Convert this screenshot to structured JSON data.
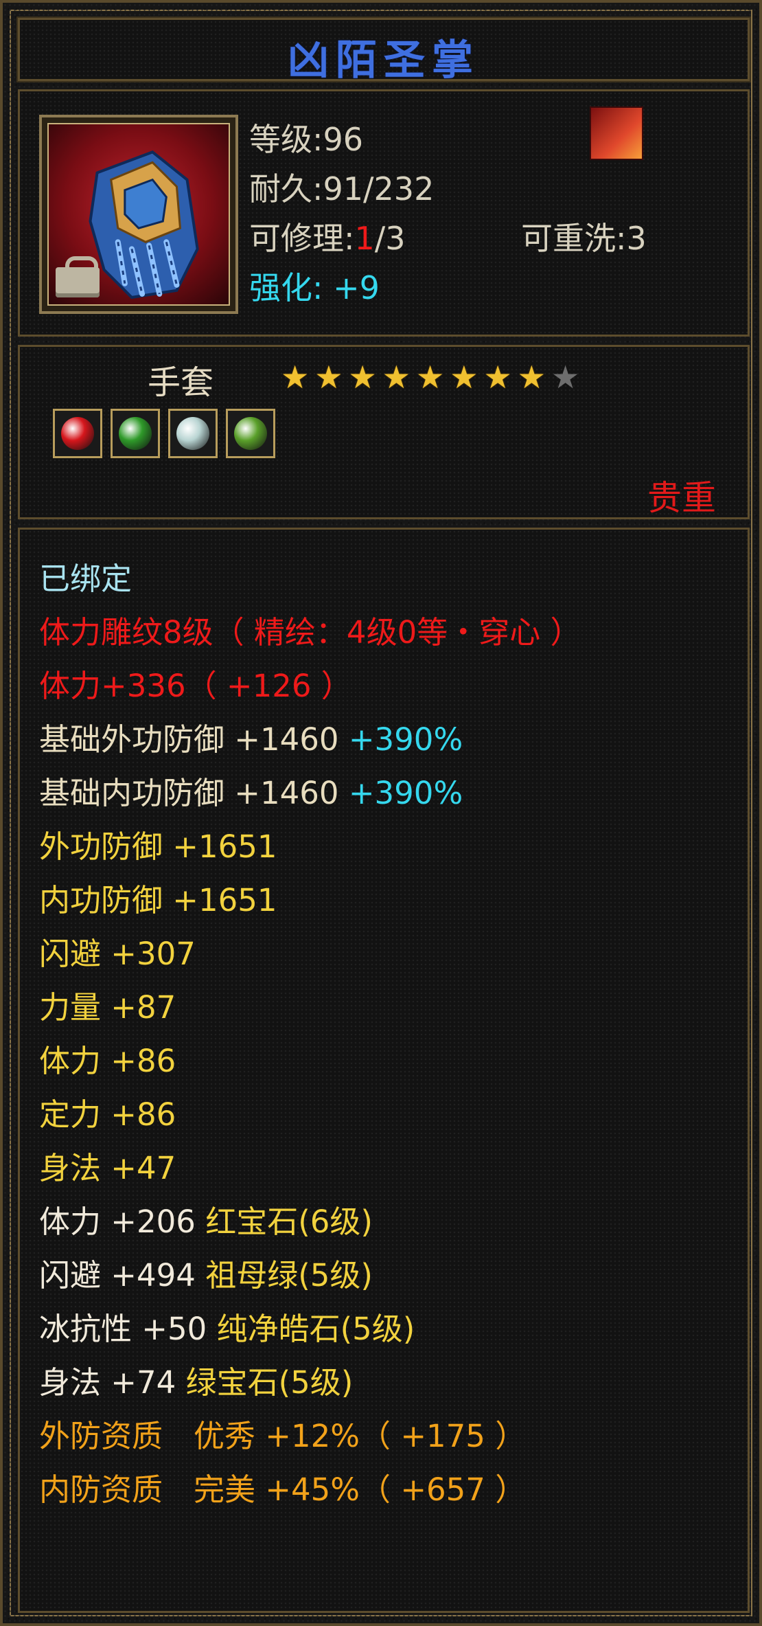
{
  "item": {
    "name": "凶陌圣掌",
    "type": "手套",
    "rarity": "贵重"
  },
  "stats": {
    "level_label": "等级:96",
    "durability_label": "耐久:91/232",
    "repair_prefix": "可修理:",
    "repair_used": "1",
    "repair_total": "/3",
    "rewash_label": "可重洗:3",
    "enhance_label": "强化:",
    "enhance_value": "+9"
  },
  "stars": {
    "filled": 8,
    "total": 9
  },
  "gems": [
    {
      "name": "red-gem-icon",
      "color": "#d6161c"
    },
    {
      "name": "emerald-gem-icon",
      "color": "#2f9a2a"
    },
    {
      "name": "white-gem-icon",
      "color": "#b8d4d2"
    },
    {
      "name": "green-gem-icon",
      "color": "#5aa02a"
    }
  ],
  "attributes": {
    "bound": "已绑定",
    "engraving": "体力雕纹8级（ 精绘：4级0等・穿心 ）",
    "stamina_total": "体力+336（ +126 ）",
    "base_ext_def": "基础外功防御 +1460",
    "base_ext_def_pct": "+390%",
    "base_int_def": "基础内功防御 +1460",
    "base_int_def_pct": "+390%",
    "ext_def": "外功防御 +1651",
    "int_def": "内功防御 +1651",
    "dodge": "闪避 +307",
    "strength": "力量 +87",
    "stamina": "体力 +86",
    "focus": "定力 +86",
    "agility": "身法 +47",
    "gem1_stat": "体力 +206",
    "gem1_name": "红宝石(6级)",
    "gem2_stat": "闪避 +494",
    "gem2_name": "祖母绿(5级)",
    "gem3_stat": "冰抗性 +50",
    "gem3_name": "纯净皓石(5级)",
    "gem4_stat": "身法 +74",
    "gem4_name": "绿宝石(5级)",
    "quality_ext": "外防资质　优秀 +12%（ +175 ）",
    "quality_int": "内防资质　完美 +45%（ +657 ）"
  }
}
